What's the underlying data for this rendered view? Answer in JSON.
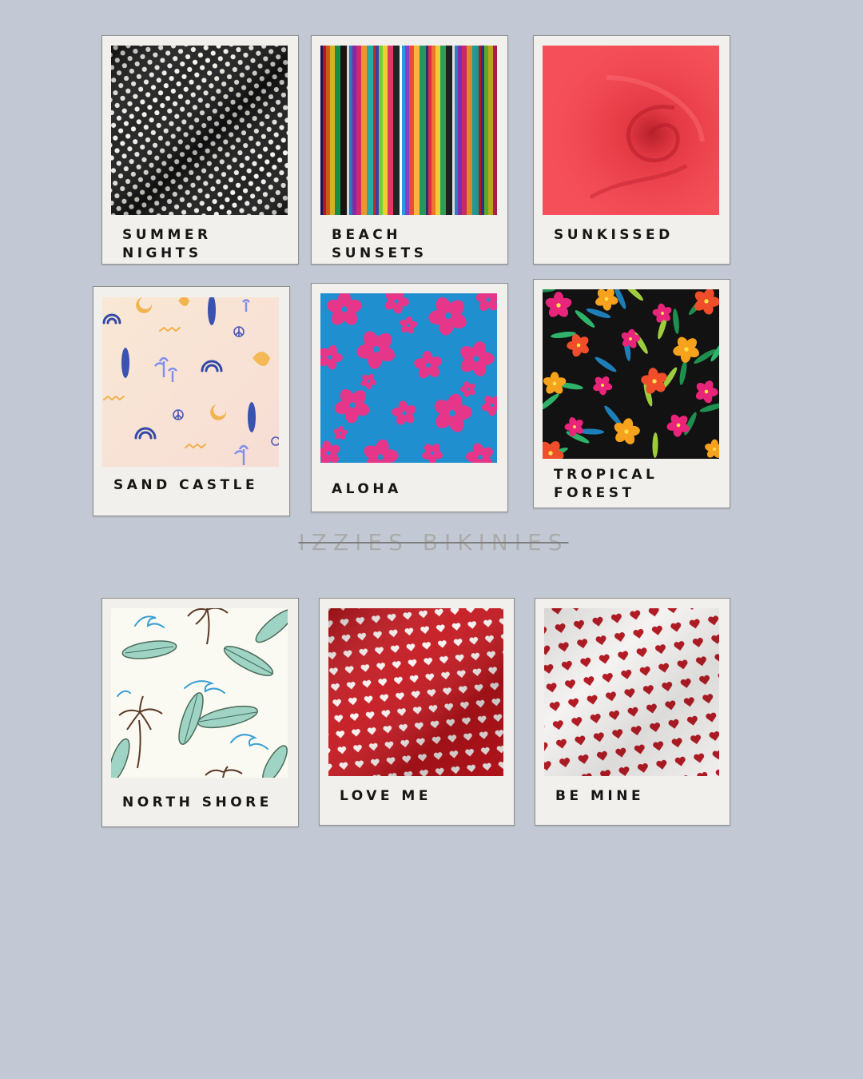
{
  "brand": {
    "title": "IZZIES BIKINIES"
  },
  "fabrics": [
    {
      "name": "SUMMER\nNIGHTS",
      "pattern": "white-polka-dots-on-black"
    },
    {
      "name": "BEACH\nSUNSETS",
      "pattern": "serape-rainbow-stripes"
    },
    {
      "name": "SUNKISSED",
      "pattern": "solid-coral-red"
    },
    {
      "name": "SAND CASTLE",
      "pattern": "beach-icons-on-peach"
    },
    {
      "name": "ALOHA",
      "pattern": "pink-hibiscus-on-blue"
    },
    {
      "name": "TROPICAL\nFOREST",
      "pattern": "tropical-flowers-on-black"
    },
    {
      "name": "NORTH SHORE",
      "pattern": "surfboards-palms-waves"
    },
    {
      "name": "LOVE ME",
      "pattern": "white-hearts-on-red"
    },
    {
      "name": "BE MINE",
      "pattern": "red-hearts-on-white"
    }
  ],
  "colors": {
    "background": "#c3c9d4",
    "card": "#f1f0ec",
    "sunkissed": "#f0444f",
    "aloha_blue": "#1f8fcf",
    "aloha_pink": "#e5368a",
    "love_me_red": "#c4151d"
  }
}
